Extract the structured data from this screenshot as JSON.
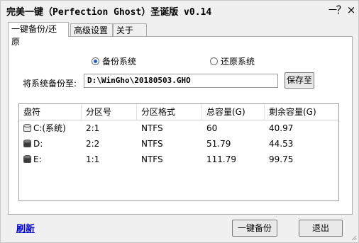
{
  "window": {
    "title": "完美一键（Perfection Ghost）圣诞版 v0.14",
    "buttons": {
      "minimize": "－",
      "help": "？",
      "close": "×"
    }
  },
  "tabs": [
    {
      "label": "一键备份/还原",
      "active": true
    },
    {
      "label": "高级设置",
      "active": false
    },
    {
      "label": "关于",
      "active": false
    }
  ],
  "mode": {
    "backup_label": "备份系统",
    "restore_label": "还原系统",
    "selected": "backup"
  },
  "save": {
    "label": "将系统备份至:",
    "path_value": "D:\\WinGho\\20180503.GHO",
    "button_label": "保存至"
  },
  "table": {
    "headers": [
      "盘符",
      "分区号",
      "分区格式",
      "总容量(G)",
      "剩余容量(G)"
    ],
    "rows": [
      {
        "icon": "system-drive-icon",
        "drive": "C:(系统)",
        "partition": "2:1",
        "format": "NTFS",
        "total": "60",
        "free": "40.97"
      },
      {
        "icon": "drive-icon",
        "drive": "D:",
        "partition": "2:2",
        "format": "NTFS",
        "total": "51.79",
        "free": "44.53"
      },
      {
        "icon": "drive-icon",
        "drive": "E:",
        "partition": "1:1",
        "format": "NTFS",
        "total": "111.79",
        "free": "99.75"
      }
    ]
  },
  "footer": {
    "refresh_label": "刷新",
    "backup_button": "一键备份",
    "exit_button": "退出"
  }
}
